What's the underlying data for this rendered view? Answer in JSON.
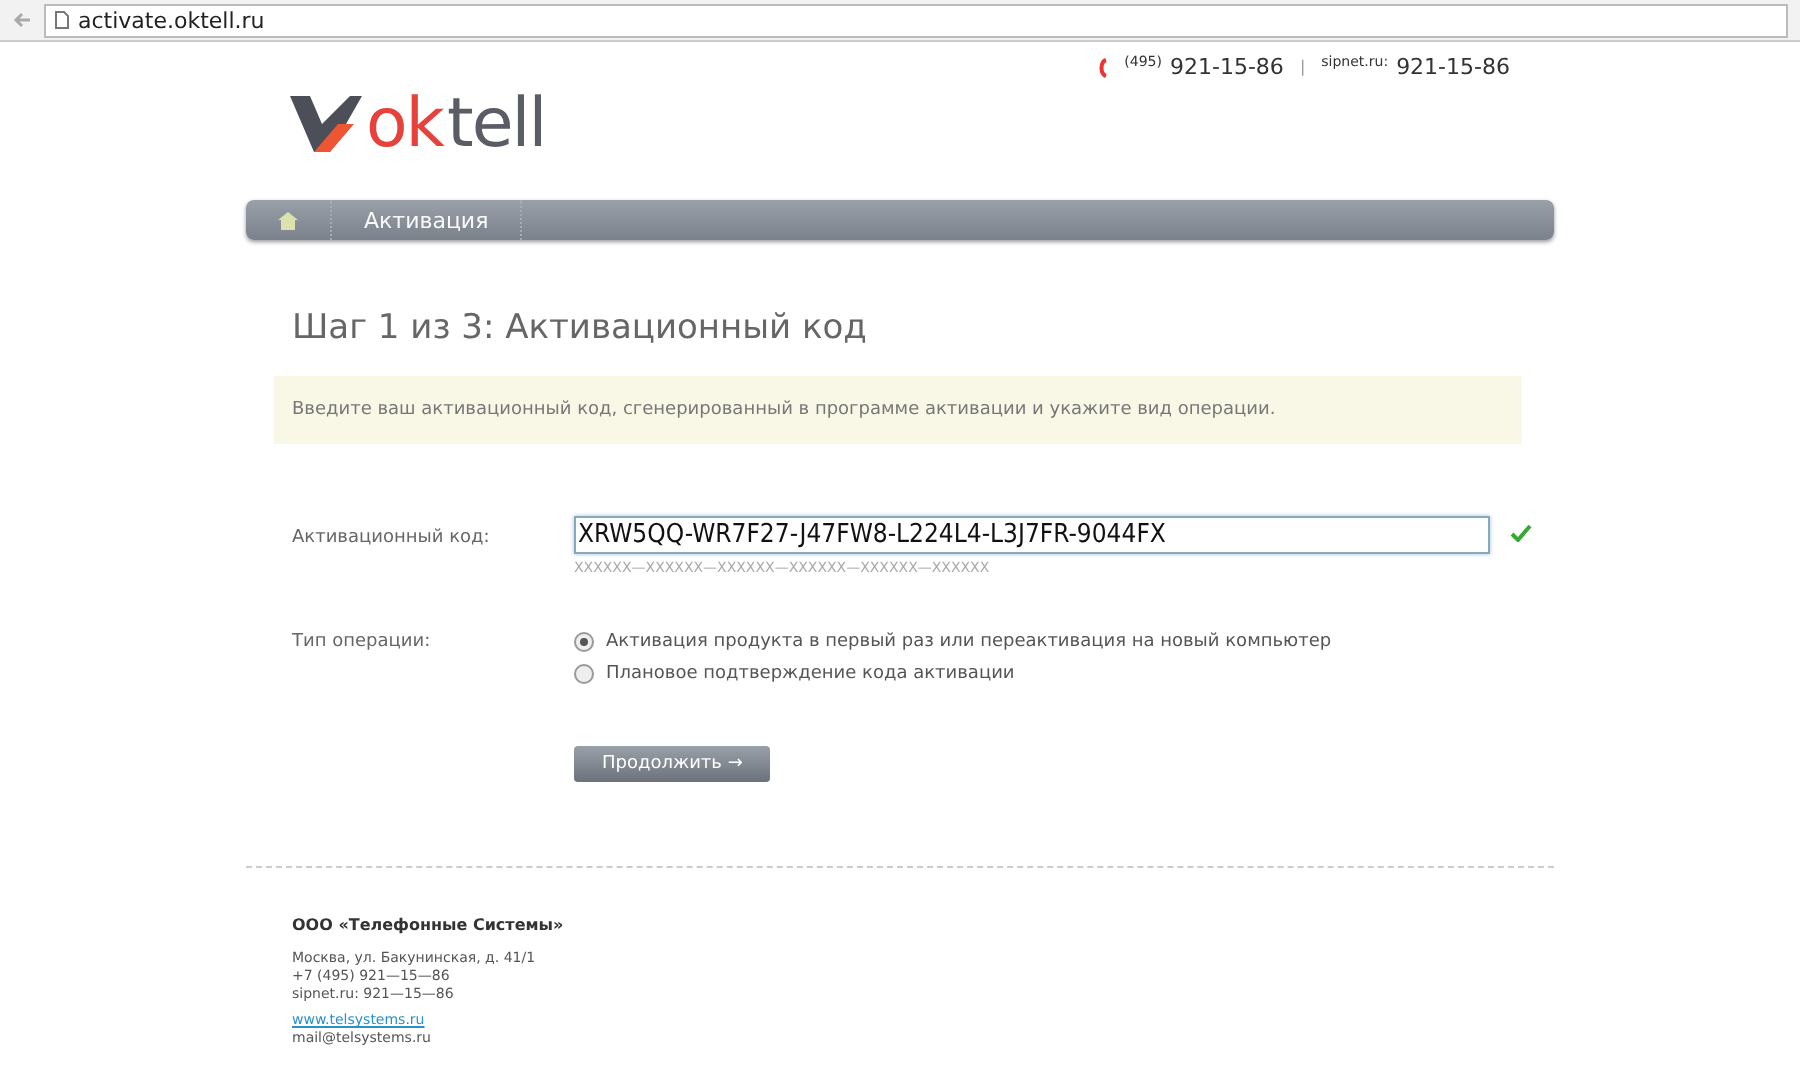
{
  "browser": {
    "url": "activate.oktell.ru"
  },
  "header": {
    "phones": [
      {
        "prefix": "(495)",
        "number": "921-15-86"
      },
      {
        "prefix": "sipnet.ru:",
        "number": "921-15-86"
      }
    ],
    "separator": "|"
  },
  "logo": {
    "part_1": "ok",
    "part_2": "tell"
  },
  "nav": {
    "items": [
      {
        "kind": "home"
      },
      {
        "kind": "text",
        "label": "Активация"
      }
    ]
  },
  "heading": "Шаг 1 из 3: Активационный код",
  "notice": "Введите ваш активационный код, сгенерированный в программе активации и укажите вид операции.",
  "form": {
    "code_label": "Активационный код:",
    "code_value": "XRW5QQ-WR7F27-J47FW8-L224L4-L3J7FR-9044FX",
    "code_valid": true,
    "code_hint": "XXXXXX—XXXXXX—XXXXXX—XXXXXX—XXXXXX—XXXXXX",
    "operation_label": "Тип операции:",
    "options": [
      {
        "label": "Активация продукта в первый раз или переактивация на новый компьютер",
        "selected": true
      },
      {
        "label": "Плановое подтверждение кода активации",
        "selected": false
      }
    ],
    "submit": "Продолжить →"
  },
  "footer": {
    "company": "ООО «Телефонные Системы»",
    "lines": [
      "Москва, ул. Бакунинская, д. 41/1",
      "+7 (495) 921—15—86",
      "sipnet.ru: 921—15—86"
    ],
    "link": "www.telsystems.ru",
    "email": "mail@telsystems.ru"
  }
}
